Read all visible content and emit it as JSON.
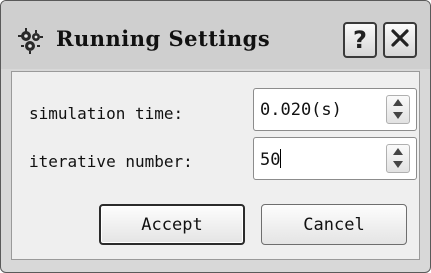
{
  "window": {
    "title": "Running Settings",
    "help_label": "?",
    "icon": "gear-cluster-icon"
  },
  "form": {
    "simulation_time": {
      "label": "simulation time:",
      "value": "0.020(s)"
    },
    "iterative_number": {
      "label": "iterative number:",
      "value": "50"
    }
  },
  "buttons": {
    "accept_label": "Accept",
    "cancel_label": "Cancel"
  },
  "colors": {
    "window_bg": "#d8d8d8",
    "client_bg": "#efefef",
    "field_bg": "#ffffff"
  }
}
